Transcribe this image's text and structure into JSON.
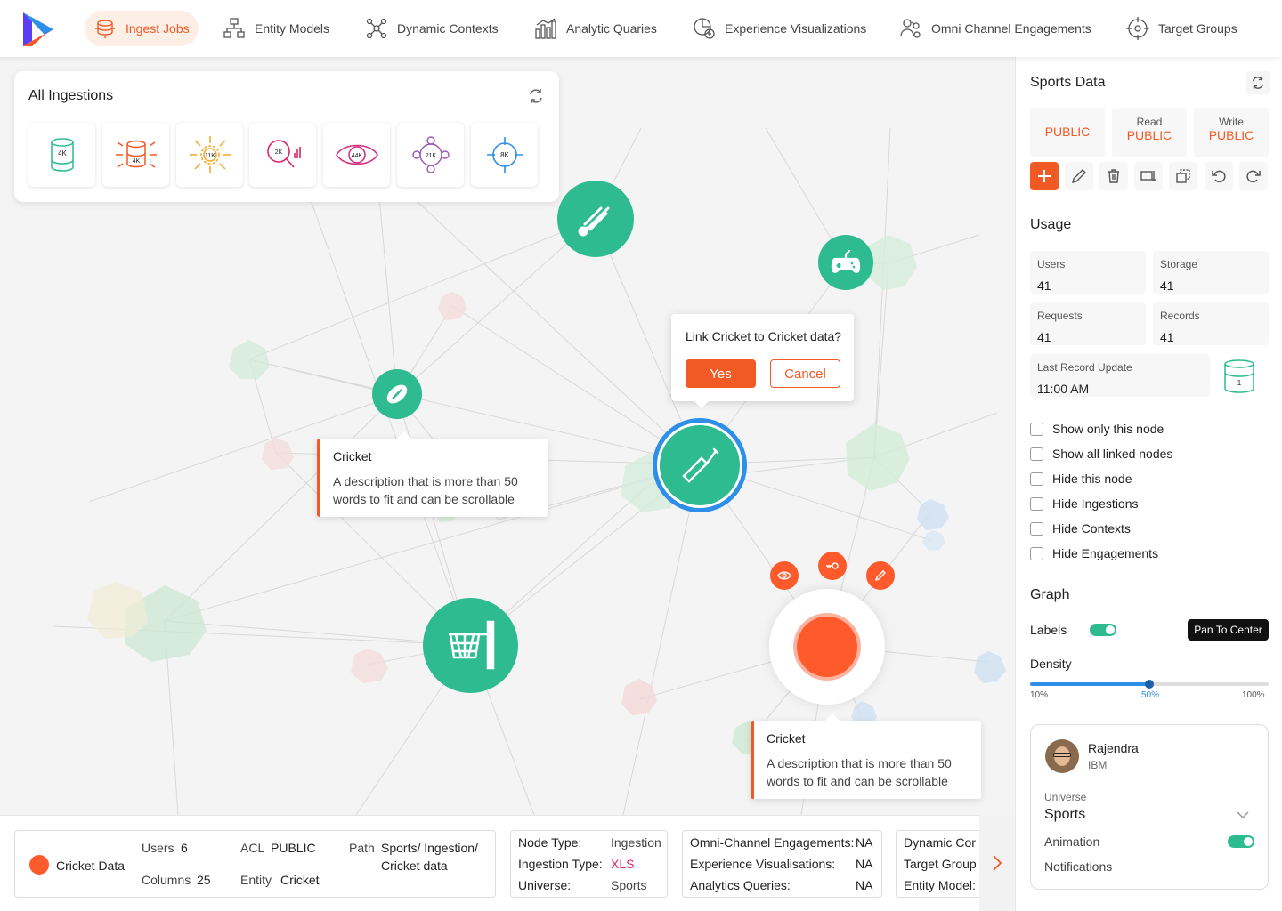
{
  "nav": {
    "items": [
      {
        "label": "Ingest Jobs",
        "icon": "ingest-icon",
        "active": true
      },
      {
        "label": "Entity Models",
        "icon": "entity-model-icon"
      },
      {
        "label": "Dynamic Contexts",
        "icon": "dynamic-context-icon"
      },
      {
        "label": "Analytic Quaries",
        "icon": "analytics-bars-icon"
      },
      {
        "label": "Experience Visualizations",
        "icon": "visualization-icon"
      },
      {
        "label": "Omni Channel Engagements",
        "icon": "engagement-icon"
      },
      {
        "label": "Target Groups",
        "icon": "target-icon"
      }
    ],
    "accent_color": "#f15a24",
    "active_bg": "#fdeee6"
  },
  "ingestions": {
    "title": "All Ingestions",
    "cards": [
      {
        "count": "4K",
        "icon": "database-icon",
        "color": "#2dbb8f"
      },
      {
        "count": "4K",
        "icon": "database-burst-icon",
        "color": "#f15a24"
      },
      {
        "count": "11K",
        "icon": "gear-burst-icon",
        "color": "#f5a623"
      },
      {
        "count": "2K",
        "icon": "search-chart-icon",
        "color": "#e0245e"
      },
      {
        "count": "44K",
        "icon": "eye-icon",
        "color": "#d63384"
      },
      {
        "count": "21K",
        "icon": "users-network-icon",
        "color": "#9b59b6"
      },
      {
        "count": "8K",
        "icon": "crosshair-icon",
        "color": "#2d8fe8"
      }
    ]
  },
  "graph": {
    "node_color": "#2dbb8f",
    "nodes": [
      {
        "name": "badminton",
        "icon": "shuttlecock-icon"
      },
      {
        "name": "gaming",
        "icon": "gamepad-icon"
      },
      {
        "name": "football",
        "icon": "football-icon"
      },
      {
        "name": "cricket",
        "icon": "cricket-bat-icon"
      },
      {
        "name": "basketball",
        "icon": "basketball-hoop-icon"
      }
    ],
    "tooltip_left": {
      "title": "Cricket",
      "description": "A description that is more than 50 words to fit and can be scrollable"
    },
    "tooltip_bottom": {
      "title": "Cricket",
      "description": "A description that is more than 50 words to fit and can be scrollable"
    },
    "link_dialog": {
      "question": "Link Cricket to Cricket data?",
      "yes": "Yes",
      "cancel": "Cancel"
    },
    "selected_node_color": "#ff5a2c"
  },
  "right_panel": {
    "title": "Sports Data",
    "acl": [
      {
        "label": "",
        "value": "PUBLIC"
      },
      {
        "label": "Read",
        "value": "PUBLIC"
      },
      {
        "label": "Write",
        "value": "PUBLIC"
      }
    ],
    "usage": {
      "heading": "Usage",
      "users": {
        "label": "Users",
        "value": "41"
      },
      "storage": {
        "label": "Storage",
        "value": "41"
      },
      "requests": {
        "label": "Requests",
        "value": "41"
      },
      "records": {
        "label": "Records",
        "value": "41"
      },
      "last_update": {
        "label": "Last Record Update",
        "value": "11:00 AM"
      },
      "db_badge": "1"
    },
    "checkboxes": [
      "Show only this node",
      "Show all linked nodes",
      "Hide this node",
      "Hide Ingestions",
      "Hide Contexts",
      "Hide Engagements"
    ],
    "graph": {
      "heading": "Graph",
      "labels_label": "Labels",
      "labels_on": true,
      "pan_button": "Pan To Center",
      "density_label": "Density",
      "density_value": 0.5,
      "density_min": "10%",
      "density_mid": "50%",
      "density_max": "100%"
    },
    "user_card": {
      "name": "Rajendra",
      "org": "IBM",
      "universe_label": "Universe",
      "universe_value": "Sports",
      "animation_label": "Animation",
      "animation_on": true,
      "notifications_label": "Notifications"
    }
  },
  "bottom": {
    "summary": {
      "name": "Cricket Data",
      "users_label": "Users",
      "users_value": "6",
      "columns_label": "Columns",
      "columns_value": "25",
      "acl_label": "ACL",
      "acl_value": "PUBLIC",
      "entity_label": "Entity",
      "entity_value": "Cricket",
      "path_label": "Path",
      "path_line1": "Sports/ Ingestion/",
      "path_line2": "Cricket data"
    },
    "node_info": {
      "node_type_label": "Node Type:",
      "node_type_value": "Ingestion",
      "ingestion_type_label": "Ingestion Type:",
      "ingestion_type_value": "XLS",
      "universe_label": "Universe:",
      "universe_value": "Sports"
    },
    "links": {
      "omni_label": "Omni-Channel Engagements:",
      "omni_value": "NA",
      "exp_label": "Experience Visualisations:",
      "exp_value": "NA",
      "analytics_label": "Analytics Queries:",
      "analytics_value": "NA"
    },
    "more": {
      "line1": "Dynamic Cor",
      "line2": "Target Group",
      "line3": "Entity Model:"
    }
  }
}
